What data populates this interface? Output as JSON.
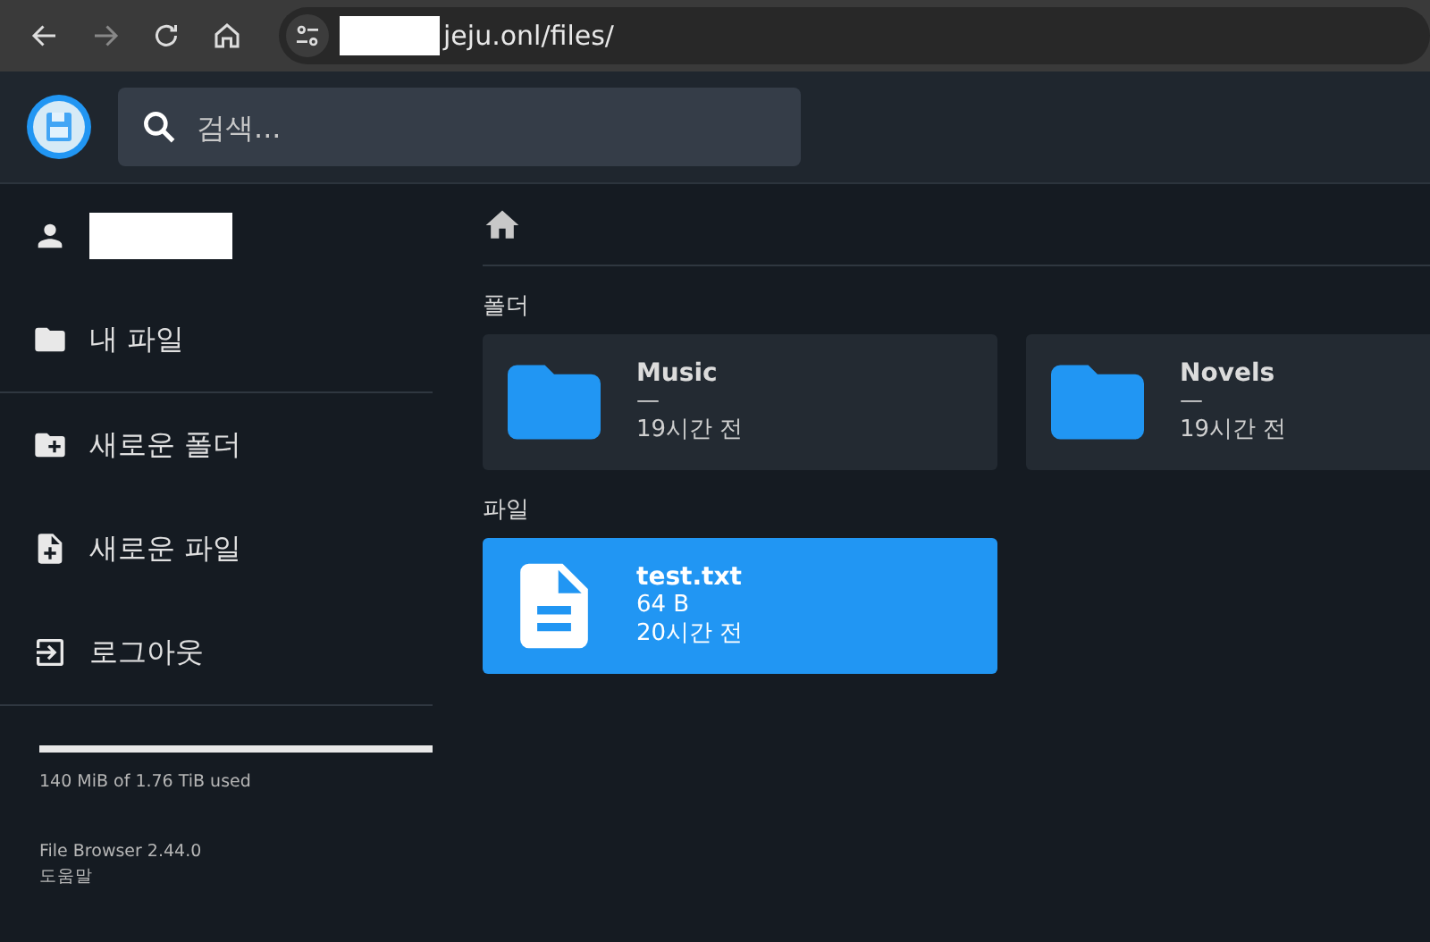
{
  "browser": {
    "url": "jeju.onl/files/"
  },
  "header": {
    "search": {
      "placeholder": "검색..."
    }
  },
  "sidebar": {
    "items": [
      {
        "kind": "user"
      },
      {
        "kind": "folder",
        "label": "내 파일"
      },
      {
        "kind": "divider"
      },
      {
        "kind": "new-folder",
        "label": "새로운 폴더"
      },
      {
        "kind": "new-file",
        "label": "새로운 파일"
      },
      {
        "kind": "logout",
        "label": "로그아웃"
      }
    ],
    "storage": {
      "level": 0,
      "text": "140 MiB of 1.76 TiB used"
    },
    "version": "File Browser 2.44.0",
    "help": "도움말"
  },
  "sections": [
    {
      "title": "폴더",
      "items": [
        {
          "kind": "folder",
          "name": "Music",
          "size": "—",
          "modified": "19시간 전",
          "selected": false
        },
        {
          "kind": "folder",
          "name": "Novels",
          "size": "—",
          "modified": "19시간 전",
          "selected": false
        }
      ]
    },
    {
      "title": "파일",
      "items": [
        {
          "kind": "file",
          "name": "test.txt",
          "size": "64 B",
          "modified": "20시간 전",
          "selected": true
        }
      ]
    }
  ]
}
